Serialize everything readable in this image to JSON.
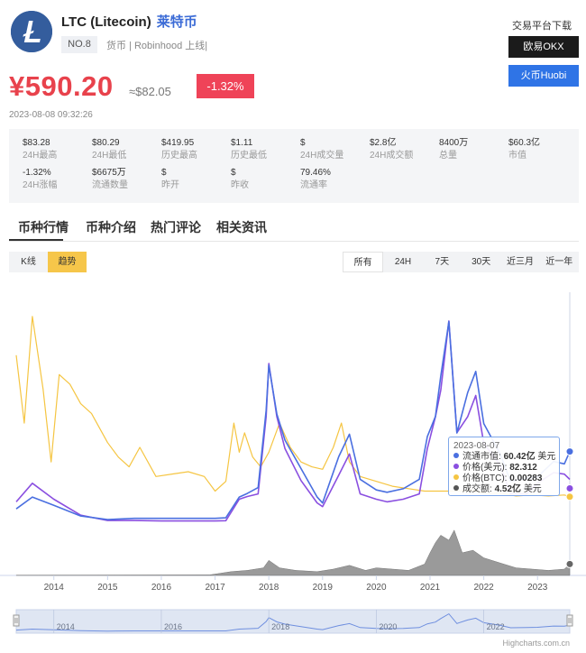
{
  "coin": {
    "symbol_line": "LTC (Litecoin)",
    "cn_name": "莱特币",
    "rank": "NO.8",
    "tags": "货币 | Robinhood 上线|",
    "price": "¥590.20",
    "usd_price": "≈$82.05",
    "change": "-1.32%",
    "timestamp": "2023-08-08 09:32:26"
  },
  "exchange": {
    "title": "交易平台下载",
    "okx_label": "欧易OKX",
    "huobi_label": "火币Huobi"
  },
  "stats": [
    {
      "value": "$83.28",
      "label": "24H最高"
    },
    {
      "value": "$80.29",
      "label": "24H最低"
    },
    {
      "value": "$419.95",
      "label": "历史最高"
    },
    {
      "value": "$1.11",
      "label": "历史最低"
    },
    {
      "value": "$",
      "label": "24H成交量"
    },
    {
      "value": "$2.8亿",
      "label": "24H成交额"
    },
    {
      "value": "8400万",
      "label": "总量"
    },
    {
      "value": "$60.3亿",
      "label": "市值"
    },
    {
      "value": "-1.32%",
      "label": "24H涨幅"
    },
    {
      "value": "$6675万",
      "label": "流通数量"
    },
    {
      "value": "$",
      "label": "昨开"
    },
    {
      "value": "$",
      "label": "昨收"
    },
    {
      "value": "79.46%",
      "label": "流通率"
    }
  ],
  "tabs": [
    "币种行情",
    "币种介绍",
    "热门评论",
    "相关资讯"
  ],
  "view_switch": {
    "kline": "K线",
    "trend": "趋势"
  },
  "ranges": [
    "所有",
    "24H",
    "7天",
    "30天",
    "近三月",
    "近一年"
  ],
  "tooltip": {
    "date": "2023-08-07",
    "rows": [
      {
        "name": "流通市值",
        "value": "60.42亿",
        "unit": "美元",
        "color": "#4a6fe0"
      },
      {
        "name": "价格(美元)",
        "value": "82.312",
        "unit": "",
        "color": "#8a4fe0"
      },
      {
        "name": "价格(BTC)",
        "value": "0.00283",
        "unit": "",
        "color": "#f5c542"
      },
      {
        "name": "成交额",
        "value": "4.52亿",
        "unit": "美元",
        "color": "#555555"
      }
    ]
  },
  "credit": "Highcharts.com.cn",
  "chart_data": {
    "type": "line",
    "x_ticks": [
      "2014",
      "2015",
      "2016",
      "2017",
      "2018",
      "2019",
      "2020",
      "2021",
      "2022",
      "2023"
    ],
    "navigator_ticks": [
      "2014",
      "2016",
      "2018",
      "2020",
      "2022"
    ],
    "x_range": [
      2013.3,
      2023.6
    ],
    "colors": {
      "market_cap": "#4a6fe0",
      "price_usd": "#8a4fe0",
      "price_btc": "#f5c542",
      "volume": "#888888",
      "navigator": "#6f8fdf"
    },
    "series": [
      {
        "name": "流通市值",
        "x": [
          2013.3,
          2013.6,
          2014.0,
          2014.5,
          2015.0,
          2015.5,
          2016.0,
          2016.5,
          2017.0,
          2017.2,
          2017.45,
          2017.6,
          2017.8,
          2017.95,
          2018.0,
          2018.15,
          2018.3,
          2018.6,
          2018.9,
          2019.0,
          2019.3,
          2019.5,
          2019.7,
          2020.0,
          2020.2,
          2020.5,
          2020.8,
          2020.95,
          2021.1,
          2021.2,
          2021.35,
          2021.5,
          2021.7,
          2021.85,
          2022.0,
          2022.3,
          2022.5,
          2022.8,
          2023.0,
          2023.3,
          2023.5,
          2023.6
        ],
        "y": [
          1.2,
          2.2,
          1.5,
          0.6,
          0.3,
          0.4,
          0.4,
          0.4,
          0.4,
          0.45,
          2.2,
          2.5,
          3.0,
          9.5,
          13.3,
          9.2,
          7.0,
          4.6,
          2.2,
          1.7,
          5.6,
          7.5,
          3.7,
          2.8,
          2.6,
          2.9,
          3.7,
          7.3,
          9.0,
          12.4,
          17.0,
          7.6,
          11.0,
          12.8,
          8.4,
          5.9,
          3.5,
          3.8,
          3.9,
          5.2,
          5.0,
          6.04
        ]
      },
      {
        "name": "价格(美元)",
        "x": [
          2013.3,
          2013.6,
          2014.0,
          2014.5,
          2015.0,
          2015.5,
          2016.0,
          2016.5,
          2017.0,
          2017.2,
          2017.45,
          2017.6,
          2017.8,
          2017.95,
          2018.0,
          2018.15,
          2018.3,
          2018.6,
          2018.9,
          2019.0,
          2019.3,
          2019.5,
          2019.7,
          2020.0,
          2020.2,
          2020.5,
          2020.8,
          2020.95,
          2021.1,
          2021.2,
          2021.35,
          2021.5,
          2021.7,
          2021.85,
          2022.0,
          2022.3,
          2022.5,
          2022.8,
          2023.0,
          2023.3,
          2023.5,
          2023.6
        ],
        "y": [
          40,
          75,
          45,
          15,
          5,
          5,
          4,
          4,
          4,
          4.5,
          45,
          50,
          55,
          200,
          300,
          200,
          140,
          80,
          38,
          31,
          90,
          130,
          55,
          45,
          40,
          45,
          55,
          140,
          200,
          250,
          380,
          170,
          200,
          240,
          150,
          110,
          55,
          55,
          75,
          95,
          92,
          82.312
        ]
      },
      {
        "name": "价格(BTC)",
        "x": [
          2013.3,
          2013.45,
          2013.6,
          2013.8,
          2013.95,
          2014.1,
          2014.3,
          2014.5,
          2014.7,
          2015.0,
          2015.2,
          2015.4,
          2015.6,
          2015.9,
          2016.2,
          2016.5,
          2016.8,
          2017.0,
          2017.2,
          2017.35,
          2017.45,
          2017.55,
          2017.7,
          2017.85,
          2018.0,
          2018.2,
          2018.4,
          2018.6,
          2018.8,
          2019.0,
          2019.2,
          2019.35,
          2019.5,
          2019.7,
          2020.0,
          2020.3,
          2020.6,
          2020.9,
          2021.2,
          2021.5,
          2021.8,
          2022.0,
          2022.3,
          2022.6,
          2022.9,
          2023.2,
          2023.5,
          2023.6
        ],
        "y": [
          0.032,
          0.018,
          0.04,
          0.025,
          0.01,
          0.028,
          0.026,
          0.022,
          0.02,
          0.014,
          0.011,
          0.009,
          0.013,
          0.007,
          0.0075,
          0.008,
          0.007,
          0.004,
          0.006,
          0.018,
          0.012,
          0.016,
          0.011,
          0.009,
          0.012,
          0.018,
          0.013,
          0.01,
          0.009,
          0.0085,
          0.013,
          0.018,
          0.01,
          0.007,
          0.006,
          0.005,
          0.0045,
          0.004,
          0.004,
          0.004,
          0.0042,
          0.0035,
          0.0036,
          0.003,
          0.0032,
          0.003,
          0.0032,
          0.00283
        ]
      },
      {
        "name": "成交额",
        "x": [
          2013.3,
          2016.9,
          2017.3,
          2017.6,
          2017.9,
          2018.0,
          2018.2,
          2018.5,
          2018.9,
          2019.2,
          2019.5,
          2019.8,
          2020.0,
          2020.3,
          2020.6,
          2020.9,
          2021.0,
          2021.1,
          2021.2,
          2021.35,
          2021.45,
          2021.6,
          2021.8,
          2022.0,
          2022.3,
          2022.6,
          2022.9,
          2023.2,
          2023.5,
          2023.6
        ],
        "y": [
          0.1,
          0.2,
          1.5,
          2.0,
          3.0,
          6.0,
          3.0,
          2.0,
          1.5,
          2.5,
          4.0,
          2.0,
          3.0,
          2.5,
          2.0,
          4.5,
          9.0,
          13.0,
          16.0,
          14.0,
          18.0,
          9.0,
          10.0,
          7.0,
          5.0,
          3.0,
          2.5,
          2.0,
          2.5,
          4.52
        ]
      }
    ]
  }
}
